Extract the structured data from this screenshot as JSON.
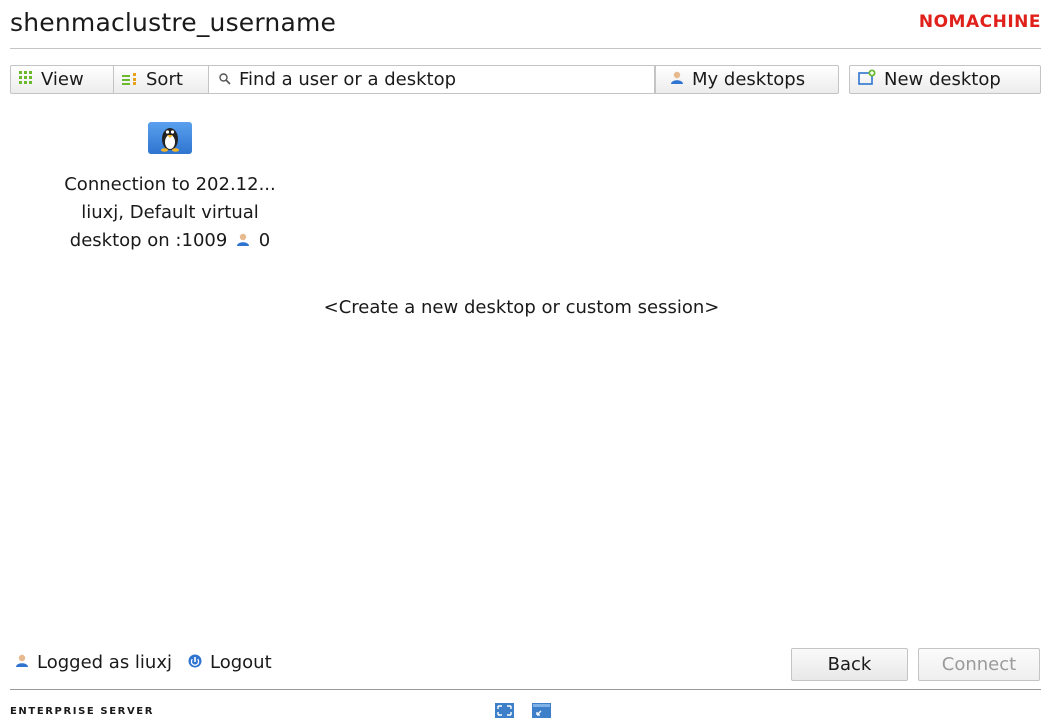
{
  "header": {
    "title": "shenmaclustre_username",
    "brand": "NOMACHINE"
  },
  "toolbar": {
    "view_label": "View",
    "sort_label": "Sort",
    "search_placeholder": "Find a user or a desktop",
    "my_desktops_label": "My desktops",
    "new_desktop_label": "New desktop"
  },
  "session": {
    "line1": "Connection to 202.12...",
    "line2": "liuxj, Default virtual",
    "line3": "desktop on :1009",
    "user_count": "0",
    "icon": "linux-tux-icon"
  },
  "create_link": "<Create a new desktop or custom session>",
  "footer": {
    "logged_as": "Logged as liuxj",
    "logout": "Logout",
    "back": "Back",
    "connect": "Connect",
    "edition": "ENTERPRISE SERVER"
  },
  "colors": {
    "brand": "#e0201b",
    "icon_blue": "#3d7fc9",
    "disabled_text": "#9a9a9a"
  }
}
